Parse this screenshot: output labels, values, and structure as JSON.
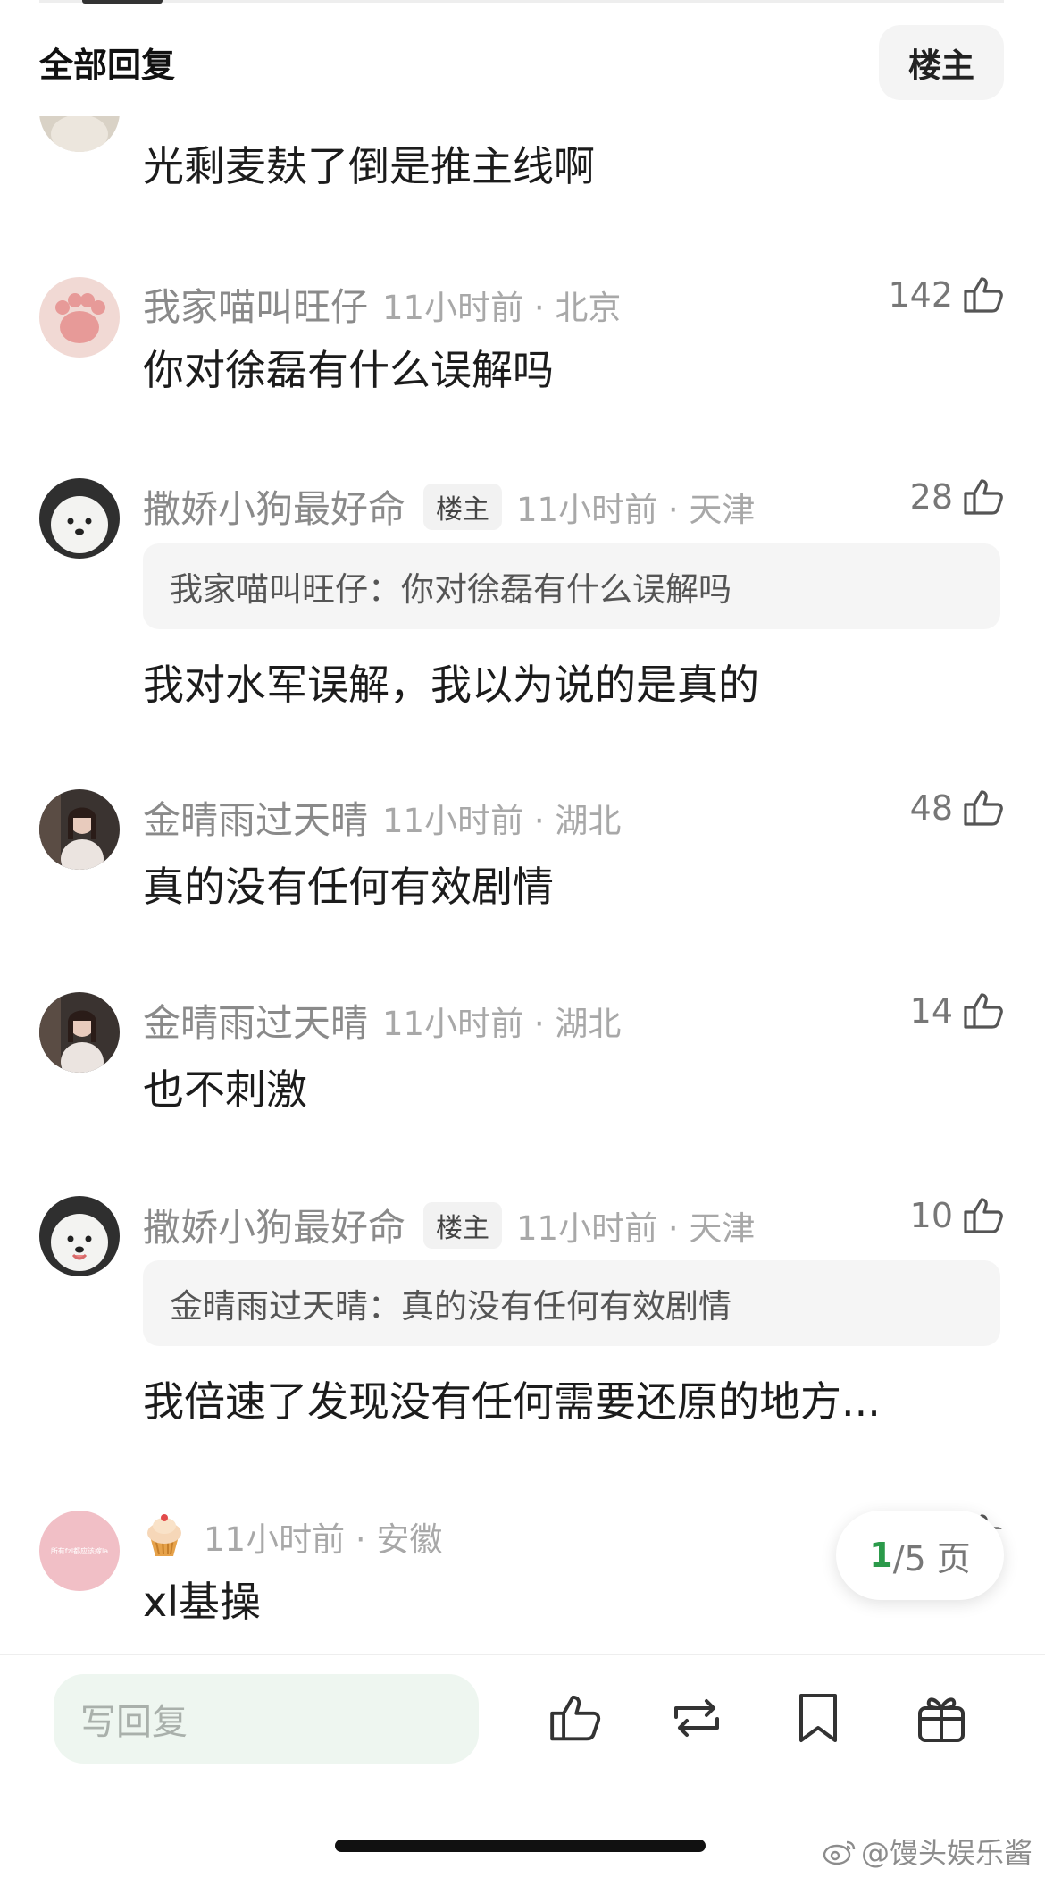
{
  "header": {
    "title": "全部回复",
    "owner_filter": "楼主"
  },
  "comments": [
    {
      "text": "光剩麦麸了倒是推主线啊"
    },
    {
      "name": "我家喵叫旺仔",
      "time": "11小时前 · 北京",
      "likes": "142",
      "text": "你对徐磊有什么误解吗"
    },
    {
      "name": "撒娇小狗最好命",
      "badge": "楼主",
      "time": "11小时前 · 天津",
      "likes": "28",
      "quote": "我家喵叫旺仔：你对徐磊有什么误解吗",
      "text": "我对水军误解，我以为说的是真的"
    },
    {
      "name": "金晴雨过天晴",
      "time": "11小时前 · 湖北",
      "likes": "48",
      "text": "真的没有任何有效剧情"
    },
    {
      "name": "金晴雨过天晴",
      "time": "11小时前 · 湖北",
      "likes": "14",
      "text": "也不刺激"
    },
    {
      "name": "撒娇小狗最好命",
      "badge": "楼主",
      "time": "11小时前 · 天津",
      "likes": "10",
      "quote": "金晴雨过天晴：真的没有任何有效剧情",
      "text": "我倍速了发现没有任何需要还原的地方..."
    },
    {
      "avatar_text": "所有fzl都应该嫁la",
      "time": "11小时前 · 安徽",
      "text": "xl基操"
    }
  ],
  "pagination": {
    "current": "1",
    "rest": "/5 页"
  },
  "bottom_bar": {
    "reply_placeholder": "写回复"
  },
  "watermark": "@馒头娱乐酱",
  "colors": {
    "accent_green": "#2b9a4a",
    "reply_bg": "#eef6f0"
  }
}
